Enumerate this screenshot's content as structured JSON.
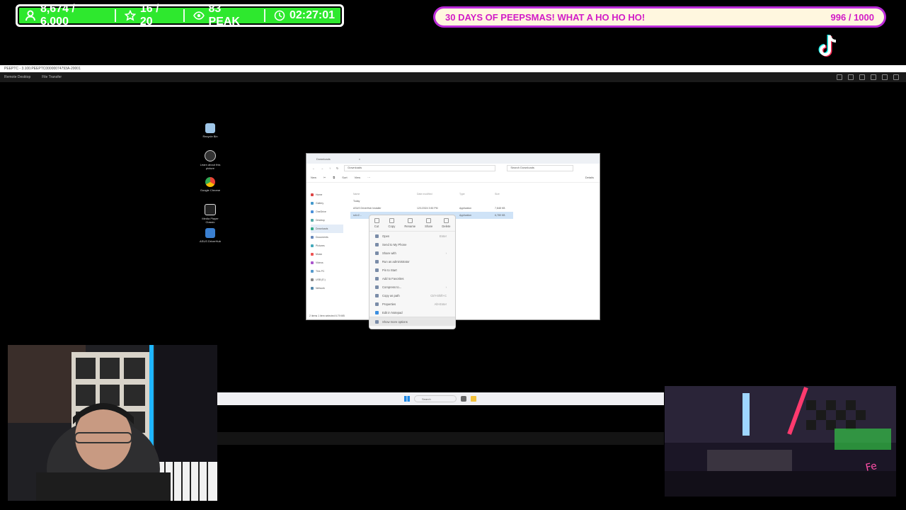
{
  "overlay": {
    "followers": "8,674 / 6,000",
    "subs": "16 / 20",
    "viewers": "83 PEAK",
    "timer": "02:27:01",
    "goal_title": "30 DAYS OF PEEPSMAS! WHAT A HO HO HO!",
    "goal_count": "996 / 1000",
    "colors": {
      "stats_bg": "#2ee82e",
      "goal_border": "#bb2bd8",
      "goal_text": "#d21cc7"
    }
  },
  "remote": {
    "title": "PEEPTC - 3.100.PEEPTC00000074793A-20001",
    "toolbar": {
      "tab1": "Remote Desktop",
      "tab2": "File Transfer"
    }
  },
  "desktop_icons": [
    {
      "label": "Recycle Bin",
      "icon": "recycle-bin-icon"
    },
    {
      "label": "Learn about this picture",
      "icon": "camera-icon"
    },
    {
      "label": "Google Chrome",
      "icon": "chrome-icon"
    },
    {
      "label": "Media Player Classic",
      "icon": "media-player-icon"
    },
    {
      "label": "ASUS DriverHub",
      "icon": "asus-icon"
    }
  ],
  "explorer": {
    "tab": "Downloads",
    "path": "Downloads",
    "search": "Search Downloads",
    "cmd": {
      "new": "New",
      "sort": "Sort",
      "view": "View",
      "details": "Details"
    },
    "nav": [
      "Home",
      "Gallery",
      "OneDrive",
      "Desktop",
      "Downloads",
      "Documents",
      "Pictures",
      "Music",
      "Videos",
      "This PC",
      "USB (E:)",
      "Network"
    ],
    "headers": {
      "name": "Name",
      "date": "Date modified",
      "type": "Type",
      "size": "Size"
    },
    "group": "Today",
    "files": [
      {
        "name": "ASUS DriverHub Installer",
        "date": "12/1/2024 3:50 PM",
        "type": "Application",
        "size": "7,848 KB"
      },
      {
        "name": "sdi-r2...",
        "date": "",
        "type": "Application",
        "size": "6,789 KB"
      }
    ],
    "status": "2 items   1 item selected  6.79 MB"
  },
  "context_menu": {
    "quick": [
      "Cut",
      "Copy",
      "Rename",
      "Share",
      "Delete"
    ],
    "items": [
      {
        "label": "Open",
        "shortcut": "Enter"
      },
      {
        "label": "Send to My Phone",
        "shortcut": ""
      },
      {
        "label": "Share with",
        "shortcut": "›"
      },
      {
        "label": "Run as administrator",
        "shortcut": ""
      },
      {
        "label": "Pin to Start",
        "shortcut": ""
      },
      {
        "label": "Add to Favorites",
        "shortcut": ""
      },
      {
        "label": "Compress to...",
        "shortcut": "›"
      },
      {
        "label": "Copy as path",
        "shortcut": "Ctrl+Shift+C"
      },
      {
        "label": "Properties",
        "shortcut": "Alt+Enter"
      },
      {
        "label": "Edit in Notepad",
        "shortcut": ""
      }
    ],
    "more": "Show more options"
  },
  "taskbar": {
    "search": "Search"
  }
}
